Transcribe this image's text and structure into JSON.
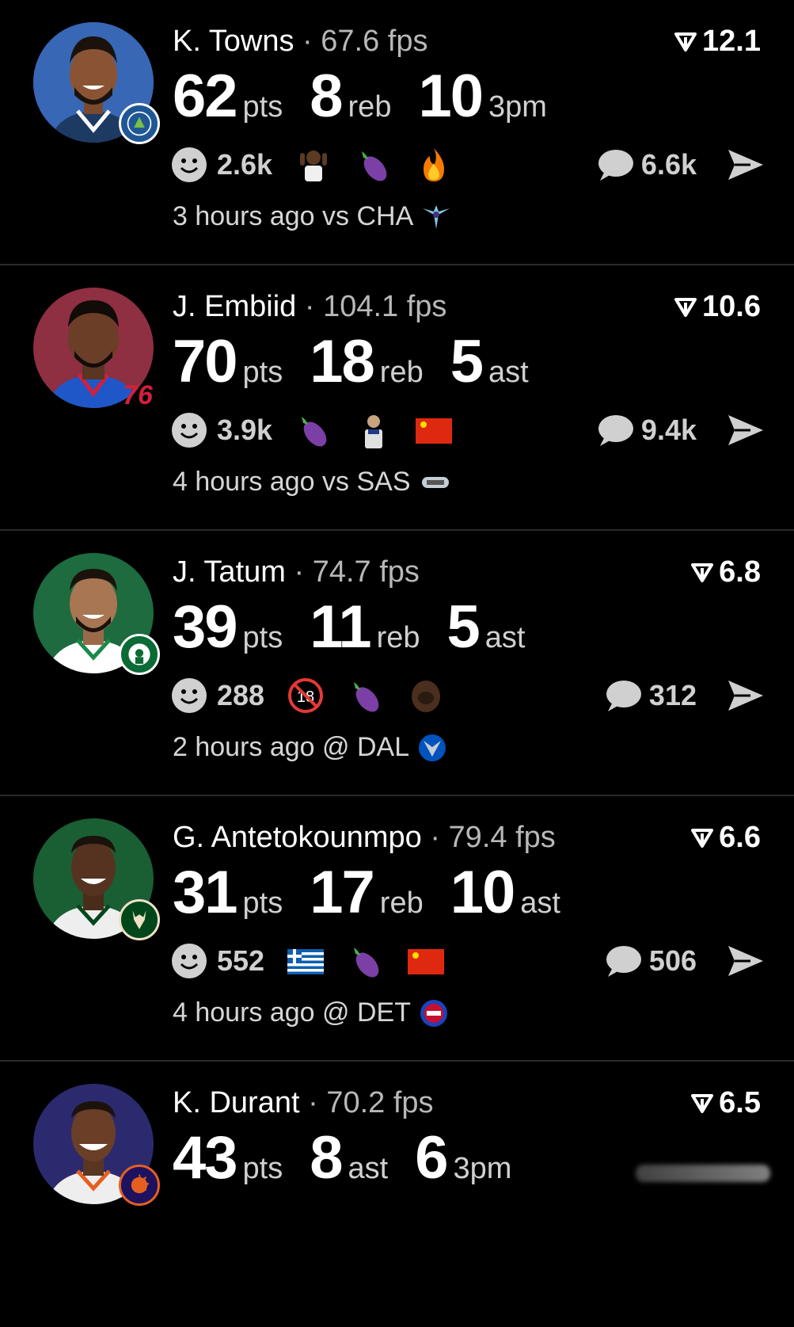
{
  "feed": [
    {
      "name": "K. Towns",
      "fps": "67.6 fps",
      "score": "12.1",
      "stats": [
        {
          "value": "62",
          "unit": "pts"
        },
        {
          "value": "8",
          "unit": "reb"
        },
        {
          "value": "10",
          "unit": "3pm"
        }
      ],
      "reaction_count": "2.6k",
      "emojis": [
        "person-emoji",
        "eggplant-emoji",
        "fire-emoji"
      ],
      "comment_count": "6.6k",
      "time": "3 hours ago vs CHA",
      "jersey_color": "#1d3a63",
      "team_color": "#1f5796"
    },
    {
      "name": "J. Embiid",
      "fps": "104.1 fps",
      "score": "10.6",
      "stats": [
        {
          "value": "70",
          "unit": "pts"
        },
        {
          "value": "18",
          "unit": "reb"
        },
        {
          "value": "5",
          "unit": "ast"
        }
      ],
      "reaction_count": "3.9k",
      "emojis": [
        "eggplant-emoji",
        "player-emoji",
        "china-flag-emoji"
      ],
      "comment_count": "9.4k",
      "time": "4 hours ago vs SAS",
      "jersey_color": "#1f57c8",
      "team_color": "#d21f3c"
    },
    {
      "name": "J. Tatum",
      "fps": "74.7 fps",
      "score": "6.8",
      "stats": [
        {
          "value": "39",
          "unit": "pts"
        },
        {
          "value": "11",
          "unit": "reb"
        },
        {
          "value": "5",
          "unit": "ast"
        }
      ],
      "reaction_count": "288",
      "emojis": [
        "no-under-18-emoji",
        "eggplant-emoji",
        "face-photo-emoji"
      ],
      "comment_count": "312",
      "time": "2 hours ago @ DAL",
      "jersey_color": "#1a8a4a",
      "team_color": "#0b6b35"
    },
    {
      "name": "G. Antetokounmpo",
      "fps": "79.4 fps",
      "score": "6.6",
      "stats": [
        {
          "value": "31",
          "unit": "pts"
        },
        {
          "value": "17",
          "unit": "reb"
        },
        {
          "value": "10",
          "unit": "ast"
        }
      ],
      "reaction_count": "552",
      "emojis": [
        "greece-flag-emoji",
        "eggplant-emoji",
        "china-flag-emoji"
      ],
      "comment_count": "506",
      "time": "4 hours ago @ DET",
      "jersey_color": "#e8e8e8",
      "team_color": "#00471b"
    },
    {
      "name": "K. Durant",
      "fps": "70.2 fps",
      "score": "6.5",
      "stats": [
        {
          "value": "43",
          "unit": "pts"
        },
        {
          "value": "8",
          "unit": "ast"
        },
        {
          "value": "6",
          "unit": "3pm"
        }
      ],
      "jersey_color": "#e8e8e8",
      "team_color": "#1d1160"
    }
  ],
  "separator": "·",
  "colors": {
    "background": "#000000",
    "muted": "#b8b8b8",
    "icon_gray": "#d0d0d0",
    "divider": "#2a2a2a"
  }
}
